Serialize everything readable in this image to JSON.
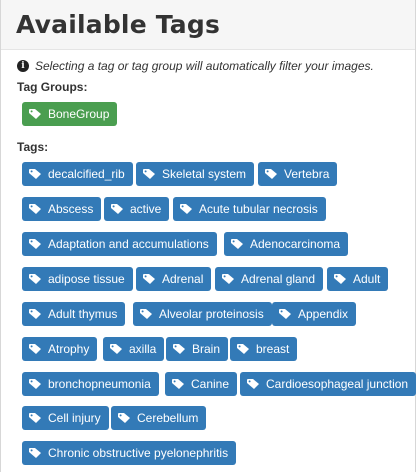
{
  "header": {
    "title": "Available Tags"
  },
  "info": {
    "icon": "info-circle-icon",
    "text": "Selecting a tag or tag group will automatically filter your images."
  },
  "tag_groups": {
    "label": "Tag Groups:",
    "items": [
      "BoneGroup"
    ],
    "color": "#4a9e50"
  },
  "tags": {
    "label": "Tags:",
    "color": "#337ab7",
    "items": [
      "decalcified_rib",
      "Skeletal system",
      "Vertebra",
      "Abscess",
      "active",
      "Acute tubular necrosis",
      "Adaptation and accumulations",
      "Adenocarcinoma",
      "adipose tissue",
      "Adrenal",
      "Adrenal gland",
      "Adult",
      "Adult thymus",
      "Alveolar proteinosis",
      "Appendix",
      "Atrophy",
      "axilla",
      "Brain",
      "breast",
      "bronchopneumonia",
      "Canine",
      "Cardioesophageal junction",
      "Cell injury",
      "Cerebellum",
      "Chronic obstructive pyelonephritis"
    ]
  }
}
